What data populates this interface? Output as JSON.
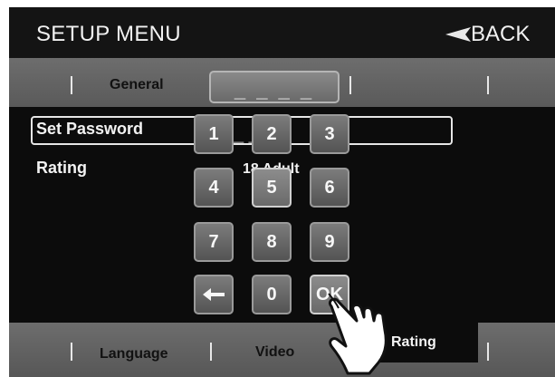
{
  "header": {
    "title": "SETUP MENU",
    "back_label": "BACK"
  },
  "top_tabs": {
    "general": "General"
  },
  "password_display": "_ _ _ _",
  "rows": [
    {
      "label": "Set Password",
      "value": "_ _ _ _"
    },
    {
      "label": "Rating",
      "value": "18 Adult"
    }
  ],
  "keypad": {
    "keys": [
      "1",
      "2",
      "3",
      "4",
      "5",
      "6",
      "7",
      "8",
      "9",
      "←",
      "0",
      "OK"
    ]
  },
  "bottom_tabs": [
    {
      "label": "Language"
    },
    {
      "label": "Video"
    },
    {
      "label": "Rating",
      "active": true
    }
  ],
  "colors": {
    "screen_bg": "#0c0c0c",
    "tabbar": "#626262",
    "key_face": "#6a6a6a",
    "text": "#f2f2f2"
  },
  "icons": {
    "back": "back-arrow-icon",
    "backspace": "left-arrow-icon",
    "pointer": "hand-pointer-icon"
  }
}
